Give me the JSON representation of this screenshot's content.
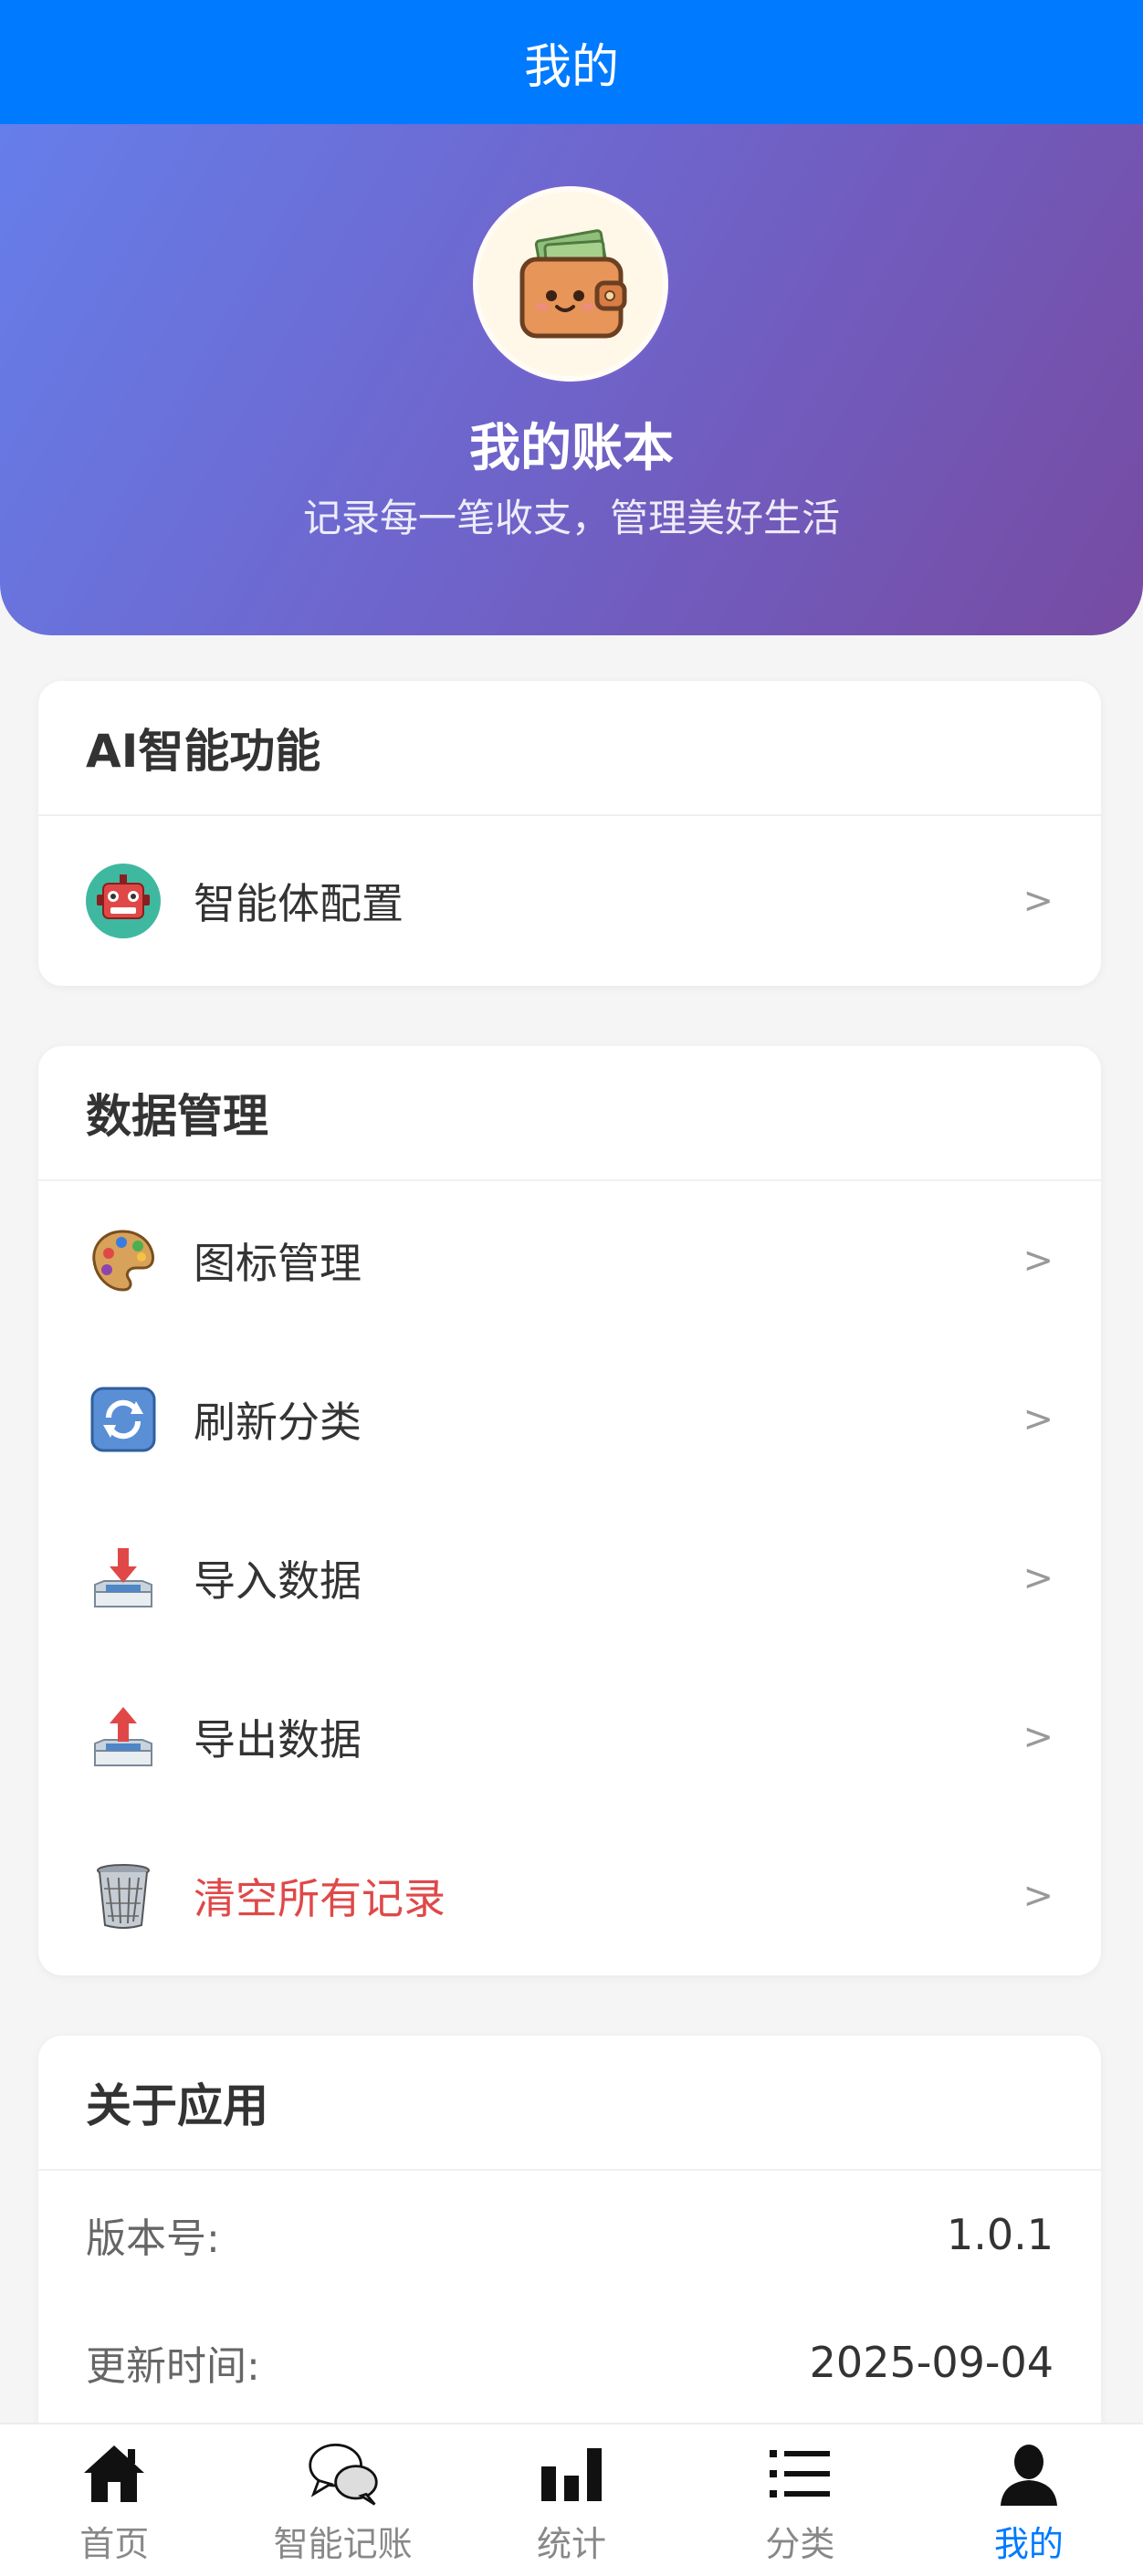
{
  "header": {
    "title": "我的"
  },
  "profile": {
    "name": "我的账本",
    "subtitle": "记录每一笔收支，管理美好生活",
    "avatar_icon": "wallet-icon"
  },
  "sections": {
    "ai": {
      "title": "AI智能功能",
      "items": [
        {
          "label": "智能体配置",
          "icon": "robot-icon",
          "chevron": ">"
        }
      ]
    },
    "data": {
      "title": "数据管理",
      "items": [
        {
          "label": "图标管理",
          "icon": "palette-icon",
          "chevron": ">"
        },
        {
          "label": "刷新分类",
          "icon": "refresh-icon",
          "chevron": ">"
        },
        {
          "label": "导入数据",
          "icon": "import-icon",
          "chevron": ">"
        },
        {
          "label": "导出数据",
          "icon": "export-icon",
          "chevron": ">"
        },
        {
          "label": "清空所有记录",
          "icon": "trash-icon",
          "chevron": ">",
          "danger_color": "#e04848"
        }
      ]
    },
    "about": {
      "title": "关于应用",
      "rows": [
        {
          "key": "版本号:",
          "value": "1.0.1"
        },
        {
          "key": "更新时间:",
          "value": "2025-09-04"
        }
      ]
    }
  },
  "tabbar": {
    "active_color": "#007aff",
    "items": [
      {
        "label": "首页",
        "icon": "home-icon"
      },
      {
        "label": "智能记账",
        "icon": "chat-icon"
      },
      {
        "label": "统计",
        "icon": "bar-chart-icon"
      },
      {
        "label": "分类",
        "icon": "list-icon"
      },
      {
        "label": "我的",
        "icon": "user-icon",
        "active": true
      }
    ]
  },
  "colors": {
    "primary": "#007aff",
    "hero_start": "#667eea",
    "hero_end": "#764ba2"
  }
}
